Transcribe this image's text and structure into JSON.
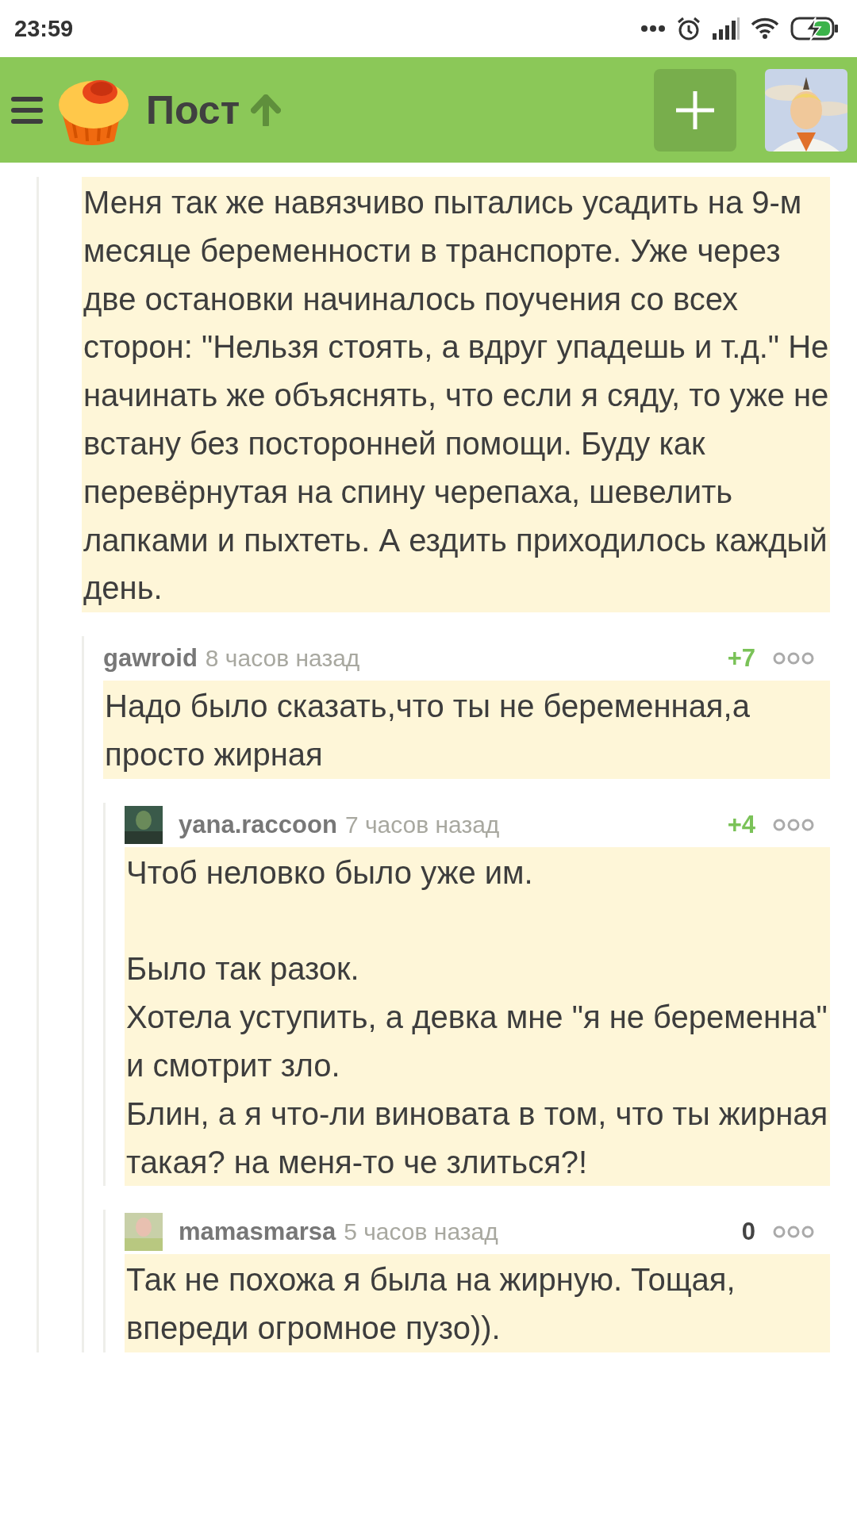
{
  "status_bar": {
    "time": "23:59"
  },
  "app_bar": {
    "title": "Пост"
  },
  "comments": [
    {
      "text": "Меня так же навязчиво пытались усадить на 9-м месяце беременности в транспорте. Уже через две остановки начиналось поучения со всех сторон: \"Нельзя стоять, а вдруг упадешь и т.д.\" Не начинать же объяснять, что если я сяду, то уже не встану без посторонней помощи. Буду как перевёрнутая на спину черепаха, шевелить лапками и пыхтеть. А ездить приходилось каждый день.",
      "children": [
        {
          "author": "gawroid",
          "time": "8 часов назад",
          "rating": "+7",
          "color": "#7ac258",
          "has_avatar": false,
          "text": "Надо было сказать,что ты не беременная,а просто жирная",
          "children": [
            {
              "author": "yana.raccoon",
              "time": "7 часов назад",
              "rating": "+4",
              "color": "#7ac258",
              "has_avatar": true,
              "text": "Чтоб неловко было уже им.\n\nБыло так разок.\nХотела уступить, а девка мне \"я не беременна\" и смотрит зло.\nБлин, а я что-ли виновата в том, что ты жирная такая? на меня-то че злиться?!"
            },
            {
              "author": "mamasmarsa",
              "time": "5 часов назад",
              "rating": "0",
              "color": "#444444",
              "has_avatar": true,
              "text": "Так не похожа я была на жирную. Тощая, впереди огромное пузо))."
            }
          ]
        }
      ]
    }
  ]
}
